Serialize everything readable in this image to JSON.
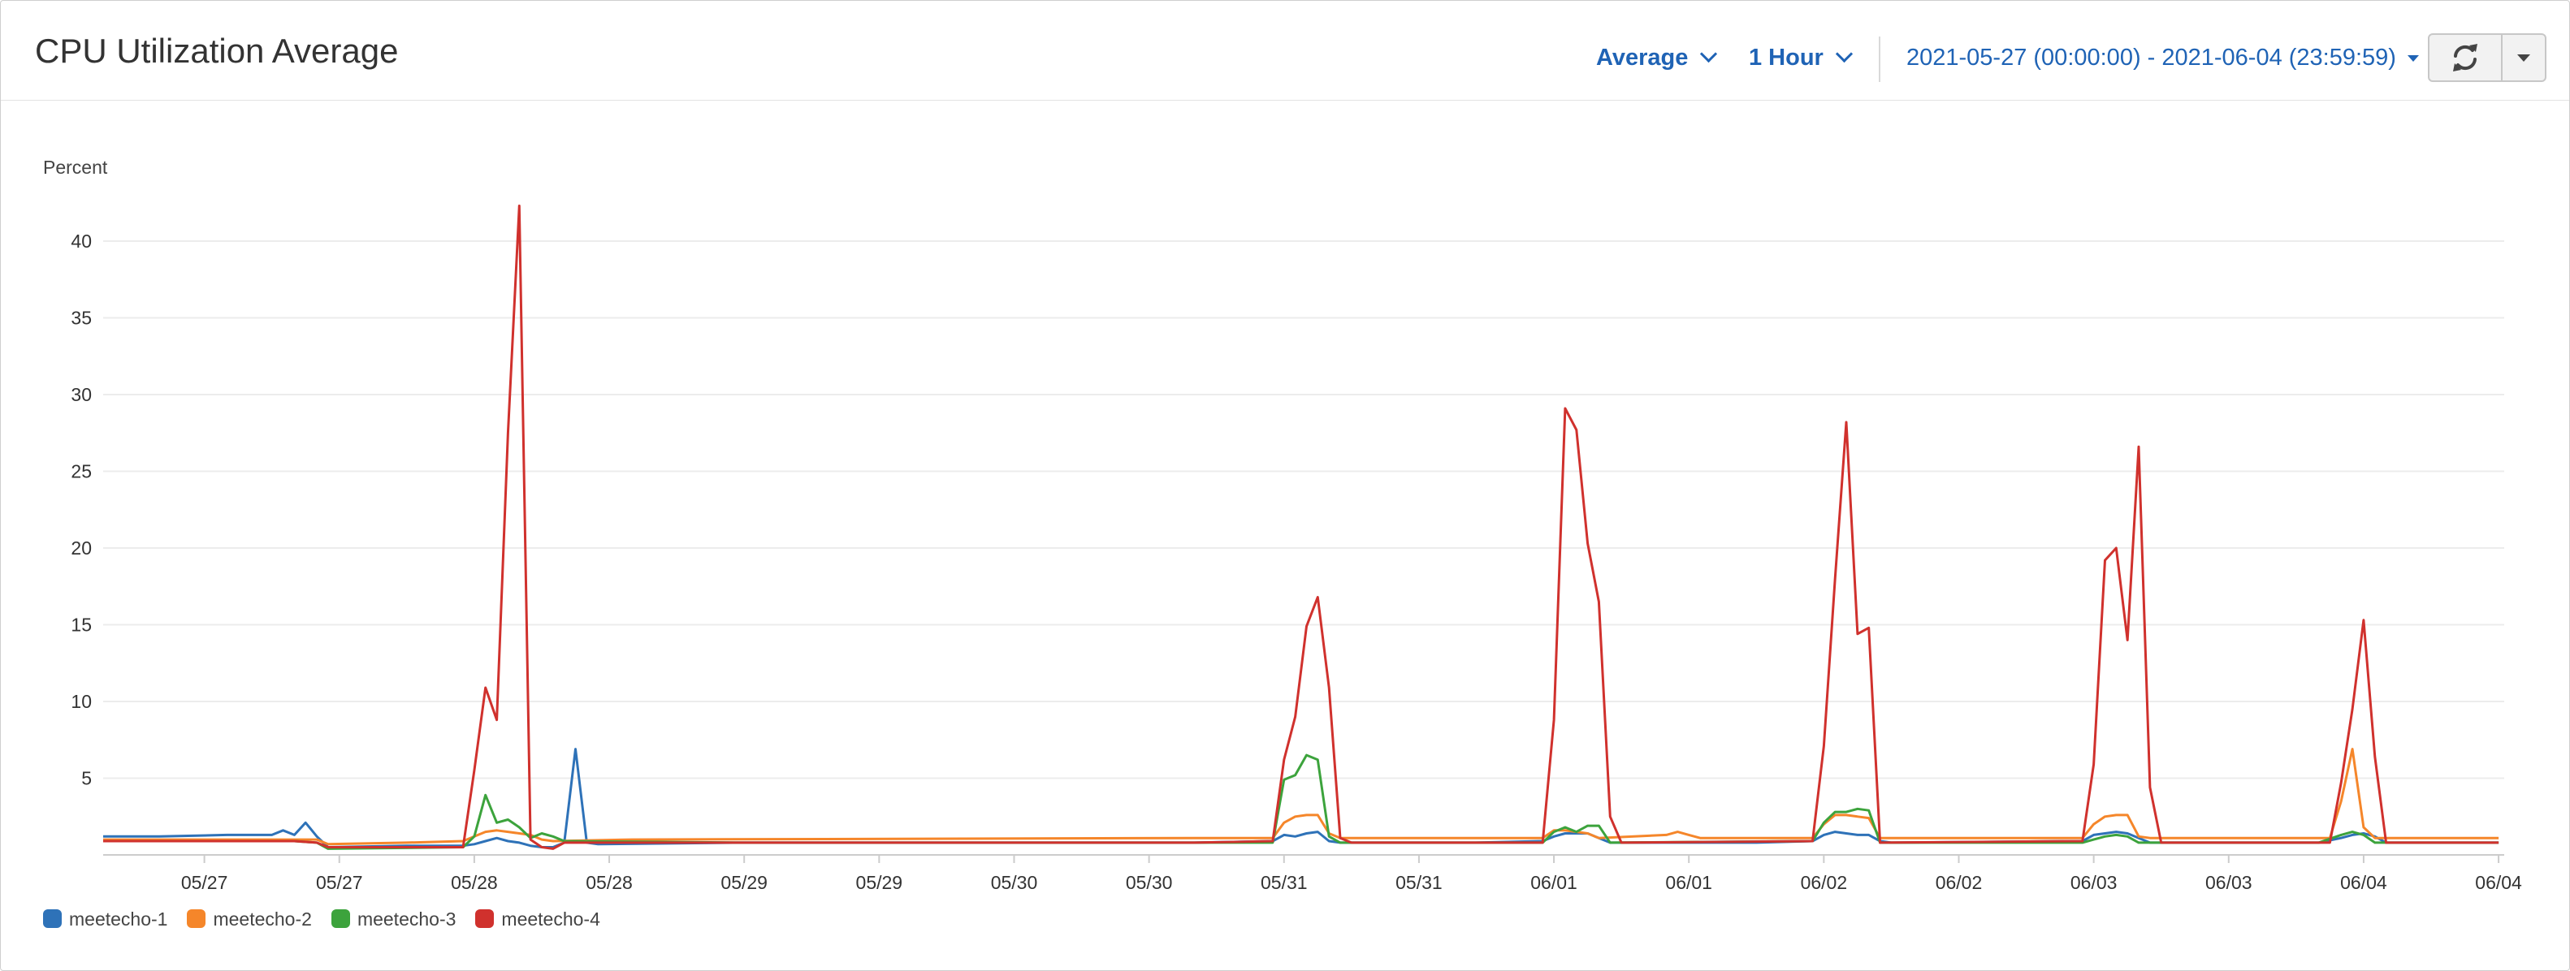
{
  "header": {
    "title": "CPU Utilization Average",
    "statistic": "Average",
    "period": "1 Hour",
    "time_range": "2021-05-27 (00:00:00) - 2021-06-04 (23:59:59)",
    "refresh_icon": "refresh-icon",
    "dropdown_icon": "caret-down-icon"
  },
  "chart_data": {
    "type": "line",
    "ylabel": "Percent",
    "ylim": [
      0,
      45
    ],
    "yticks": [
      5,
      10,
      15,
      20,
      25,
      30,
      35,
      40
    ],
    "x_tick_labels": [
      "05/27",
      "05/27",
      "05/28",
      "05/28",
      "05/29",
      "05/29",
      "05/30",
      "05/30",
      "05/31",
      "05/31",
      "06/01",
      "06/01",
      "06/02",
      "06/02",
      "06/03",
      "06/03",
      "06/04",
      "06/04"
    ],
    "x_tick_hours": [
      12,
      24,
      36,
      48,
      60,
      72,
      84,
      96,
      108,
      120,
      132,
      144,
      156,
      168,
      180,
      192,
      204,
      216
    ],
    "x_range_hours": [
      3,
      216.5
    ],
    "grid": true,
    "legend_position": "bottom-left",
    "series": [
      {
        "name": "meetecho-1",
        "color": "#2e72b8",
        "points": [
          [
            3,
            1.2
          ],
          [
            8,
            1.2
          ],
          [
            14,
            1.3
          ],
          [
            18,
            1.3
          ],
          [
            19,
            1.6
          ],
          [
            20,
            1.3
          ],
          [
            21,
            2.1
          ],
          [
            22,
            1.2
          ],
          [
            23,
            0.5
          ],
          [
            30,
            0.6
          ],
          [
            35,
            0.6
          ],
          [
            36,
            0.7
          ],
          [
            37,
            0.9
          ],
          [
            38,
            1.1
          ],
          [
            39,
            0.9
          ],
          [
            40,
            0.8
          ],
          [
            41,
            0.6
          ],
          [
            42,
            0.5
          ],
          [
            43,
            0.5
          ],
          [
            44,
            0.8
          ],
          [
            45,
            6.9
          ],
          [
            46,
            0.8
          ],
          [
            47,
            0.7
          ],
          [
            60,
            0.8
          ],
          [
            80,
            0.8
          ],
          [
            100,
            0.8
          ],
          [
            107,
            0.9
          ],
          [
            108,
            1.3
          ],
          [
            109,
            1.2
          ],
          [
            110,
            1.4
          ],
          [
            111,
            1.5
          ],
          [
            112,
            0.9
          ],
          [
            113,
            0.8
          ],
          [
            125,
            0.8
          ],
          [
            131,
            0.9
          ],
          [
            132,
            1.2
          ],
          [
            133,
            1.4
          ],
          [
            134,
            1.4
          ],
          [
            135,
            1.4
          ],
          [
            136,
            1.1
          ],
          [
            137,
            0.8
          ],
          [
            140,
            0.8
          ],
          [
            150,
            0.8
          ],
          [
            155,
            0.9
          ],
          [
            156,
            1.3
          ],
          [
            157,
            1.5
          ],
          [
            158,
            1.4
          ],
          [
            159,
            1.3
          ],
          [
            160,
            1.3
          ],
          [
            161,
            0.9
          ],
          [
            162,
            0.8
          ],
          [
            179,
            0.9
          ],
          [
            180,
            1.3
          ],
          [
            181,
            1.4
          ],
          [
            182,
            1.5
          ],
          [
            183,
            1.4
          ],
          [
            184,
            1.1
          ],
          [
            185,
            0.8
          ],
          [
            200,
            0.8
          ],
          [
            202,
            1.1
          ],
          [
            203,
            1.3
          ],
          [
            204,
            1.4
          ],
          [
            205,
            1.2
          ],
          [
            206,
            0.8
          ],
          [
            216,
            0.8
          ]
        ]
      },
      {
        "name": "meetecho-2",
        "color": "#f5862a",
        "points": [
          [
            3,
            1.0
          ],
          [
            20,
            1.0
          ],
          [
            22,
            1.0
          ],
          [
            23,
            0.7
          ],
          [
            30,
            0.8
          ],
          [
            35,
            0.9
          ],
          [
            36,
            1.2
          ],
          [
            37,
            1.5
          ],
          [
            38,
            1.6
          ],
          [
            39,
            1.5
          ],
          [
            40,
            1.4
          ],
          [
            41,
            1.3
          ],
          [
            42,
            1.0
          ],
          [
            43,
            0.9
          ],
          [
            50,
            1.0
          ],
          [
            100,
            1.1
          ],
          [
            107,
            1.1
          ],
          [
            108,
            2.1
          ],
          [
            109,
            2.5
          ],
          [
            110,
            2.6
          ],
          [
            111,
            2.6
          ],
          [
            112,
            1.4
          ],
          [
            113,
            1.1
          ],
          [
            131,
            1.1
          ],
          [
            132,
            1.6
          ],
          [
            133,
            1.6
          ],
          [
            134,
            1.5
          ],
          [
            135,
            1.4
          ],
          [
            136,
            1.1
          ],
          [
            142,
            1.3
          ],
          [
            143,
            1.5
          ],
          [
            144,
            1.3
          ],
          [
            145,
            1.1
          ],
          [
            155,
            1.1
          ],
          [
            156,
            2.0
          ],
          [
            157,
            2.6
          ],
          [
            158,
            2.6
          ],
          [
            159,
            2.5
          ],
          [
            160,
            2.4
          ],
          [
            161,
            1.1
          ],
          [
            179,
            1.1
          ],
          [
            180,
            2.0
          ],
          [
            181,
            2.5
          ],
          [
            182,
            2.6
          ],
          [
            183,
            2.6
          ],
          [
            184,
            1.2
          ],
          [
            185,
            1.1
          ],
          [
            201,
            1.1
          ],
          [
            202,
            3.5
          ],
          [
            203,
            6.9
          ],
          [
            204,
            1.8
          ],
          [
            205,
            1.1
          ],
          [
            216,
            1.1
          ]
        ]
      },
      {
        "name": "meetecho-3",
        "color": "#3ca33c",
        "points": [
          [
            3,
            0.9
          ],
          [
            20,
            0.9
          ],
          [
            22,
            0.8
          ],
          [
            23,
            0.4
          ],
          [
            35,
            0.5
          ],
          [
            36,
            1.2
          ],
          [
            37,
            3.9
          ],
          [
            38,
            2.1
          ],
          [
            39,
            2.3
          ],
          [
            40,
            1.8
          ],
          [
            41,
            1.1
          ],
          [
            42,
            1.4
          ],
          [
            43,
            1.2
          ],
          [
            44,
            0.9
          ],
          [
            60,
            0.8
          ],
          [
            100,
            0.8
          ],
          [
            107,
            0.8
          ],
          [
            108,
            4.9
          ],
          [
            109,
            5.2
          ],
          [
            110,
            6.5
          ],
          [
            111,
            6.2
          ],
          [
            112,
            1.2
          ],
          [
            113,
            0.8
          ],
          [
            131,
            0.8
          ],
          [
            132,
            1.5
          ],
          [
            133,
            1.8
          ],
          [
            134,
            1.5
          ],
          [
            135,
            1.9
          ],
          [
            136,
            1.9
          ],
          [
            137,
            0.8
          ],
          [
            155,
            0.9
          ],
          [
            156,
            2.1
          ],
          [
            157,
            2.8
          ],
          [
            158,
            2.8
          ],
          [
            159,
            3.0
          ],
          [
            160,
            2.9
          ],
          [
            161,
            0.8
          ],
          [
            179,
            0.8
          ],
          [
            180,
            1.0
          ],
          [
            181,
            1.2
          ],
          [
            182,
            1.3
          ],
          [
            183,
            1.2
          ],
          [
            184,
            0.8
          ],
          [
            200,
            0.8
          ],
          [
            202,
            1.3
          ],
          [
            203,
            1.5
          ],
          [
            204,
            1.3
          ],
          [
            205,
            0.8
          ],
          [
            216,
            0.8
          ]
        ]
      },
      {
        "name": "meetecho-4",
        "color": "#d0312d",
        "points": [
          [
            3,
            0.9
          ],
          [
            20,
            0.9
          ],
          [
            22,
            0.8
          ],
          [
            23,
            0.5
          ],
          [
            35,
            0.5
          ],
          [
            36,
            5.5
          ],
          [
            37,
            10.9
          ],
          [
            38,
            8.8
          ],
          [
            39,
            27.5
          ],
          [
            40,
            42.3
          ],
          [
            41,
            1.0
          ],
          [
            42,
            0.5
          ],
          [
            43,
            0.4
          ],
          [
            44,
            0.8
          ],
          [
            60,
            0.8
          ],
          [
            100,
            0.8
          ],
          [
            107,
            0.9
          ],
          [
            108,
            6.2
          ],
          [
            109,
            9.0
          ],
          [
            110,
            14.9
          ],
          [
            111,
            16.8
          ],
          [
            112,
            10.9
          ],
          [
            113,
            1.1
          ],
          [
            114,
            0.8
          ],
          [
            131,
            0.8
          ],
          [
            132,
            8.8
          ],
          [
            133,
            29.1
          ],
          [
            134,
            27.7
          ],
          [
            135,
            20.3
          ],
          [
            136,
            16.5
          ],
          [
            137,
            2.5
          ],
          [
            138,
            0.8
          ],
          [
            155,
            0.9
          ],
          [
            156,
            7.1
          ],
          [
            157,
            18.0
          ],
          [
            158,
            28.2
          ],
          [
            159,
            14.4
          ],
          [
            160,
            14.8
          ],
          [
            161,
            0.8
          ],
          [
            179,
            0.9
          ],
          [
            180,
            5.9
          ],
          [
            181,
            19.2
          ],
          [
            182,
            20.0
          ],
          [
            183,
            14.0
          ],
          [
            184,
            26.6
          ],
          [
            185,
            4.4
          ],
          [
            186,
            0.8
          ],
          [
            201,
            0.8
          ],
          [
            202,
            4.7
          ],
          [
            203,
            9.5
          ],
          [
            204,
            15.3
          ],
          [
            205,
            6.4
          ],
          [
            206,
            0.8
          ],
          [
            216,
            0.8
          ]
        ]
      }
    ]
  }
}
